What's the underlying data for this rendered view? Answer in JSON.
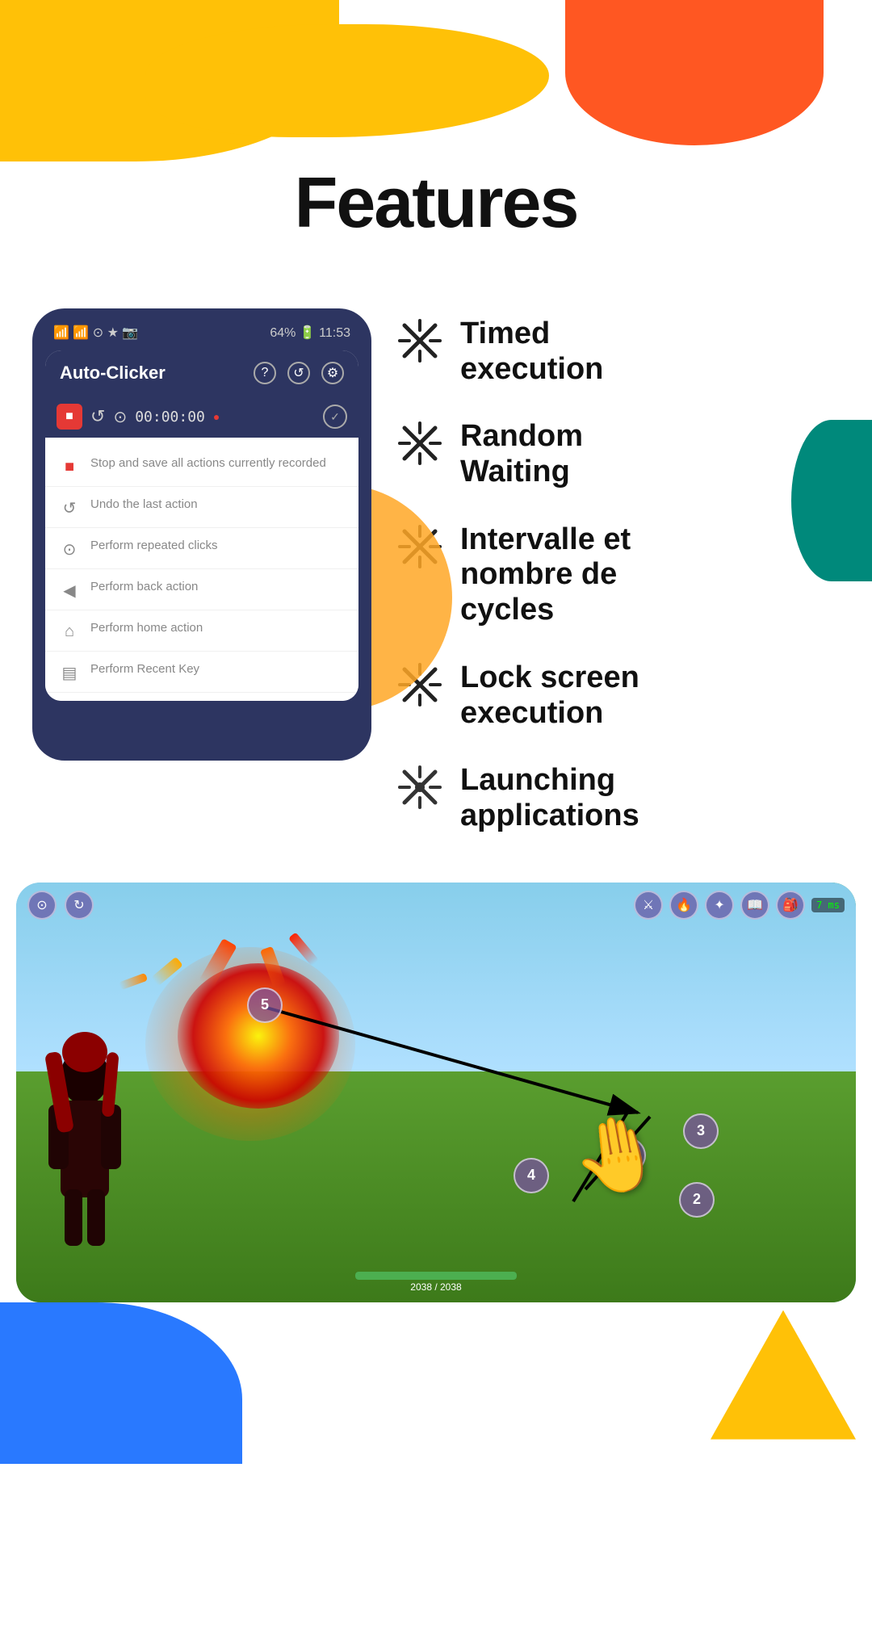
{
  "page": {
    "title": "Features"
  },
  "decorative": {
    "blob_top_yellow": "yellow",
    "blob_top_orange": "orange",
    "blob_orange_circle": "orange",
    "blob_teal": "teal",
    "blob_bottom_blue": "blue",
    "blob_bottom_yellow": "yellow"
  },
  "phone": {
    "status_left": "📶 📶 ⊙ ★ 📷",
    "status_right": "64% 🔋 11:53",
    "app_title": "Auto-Clicker",
    "question_icon": "?",
    "history_icon": "↺",
    "settings_icon": "⚙",
    "toolbar": {
      "stop_icon": "■",
      "undo_icon": "↺",
      "target_icon": "⊙",
      "timer": "00:00:00",
      "record_dot": "●",
      "check_icon": "✓"
    },
    "menu_items": [
      {
        "icon": "■",
        "icon_color": "#E53935",
        "text": "Stop and save all actions currently recorded"
      },
      {
        "icon": "↺",
        "icon_color": "#888",
        "text": "Undo the last action"
      },
      {
        "icon": "⊙",
        "icon_color": "#888",
        "text": "Perform repeated clicks"
      },
      {
        "icon": "◀",
        "icon_color": "#888",
        "text": "Perform back action"
      },
      {
        "icon": "⌂",
        "icon_color": "#888",
        "text": "Perform home action"
      },
      {
        "icon": "▤",
        "icon_color": "#888",
        "text": "Perform Recent Key"
      }
    ]
  },
  "features": [
    {
      "id": "timed-execution",
      "label": "Timed execution",
      "icon_name": "scissors-x-icon"
    },
    {
      "id": "random-waiting",
      "label": "Random Waiting",
      "icon_name": "scissors-x-icon"
    },
    {
      "id": "intervalle-cycles",
      "label": "Intervalle et nombre de cycles",
      "icon_name": "scissors-x-icon"
    },
    {
      "id": "lock-screen-execution",
      "label": "Lock screen execution",
      "icon_name": "scissors-x-icon"
    },
    {
      "id": "launching-applications",
      "label": "Launching applications",
      "icon_name": "scissors-x-icon"
    }
  ],
  "game": {
    "click_points": [
      {
        "id": 1,
        "label": "1",
        "bottom": "160",
        "right": "260"
      },
      {
        "id": 2,
        "label": "2",
        "bottom": "100",
        "right": "180"
      },
      {
        "id": 3,
        "label": "3",
        "bottom": "200",
        "right": "140"
      },
      {
        "id": 4,
        "label": "4",
        "bottom": "130",
        "right": "390"
      },
      {
        "id": 5,
        "label": "5",
        "top": "130",
        "left": "260"
      }
    ],
    "hud_left_icons": [
      "⊙",
      "↻"
    ],
    "hud_right_icons": [
      "⚔",
      "🔥",
      "✦",
      "📖",
      "🎒"
    ],
    "ping": "7 ms",
    "health": "2038 / 2038"
  }
}
